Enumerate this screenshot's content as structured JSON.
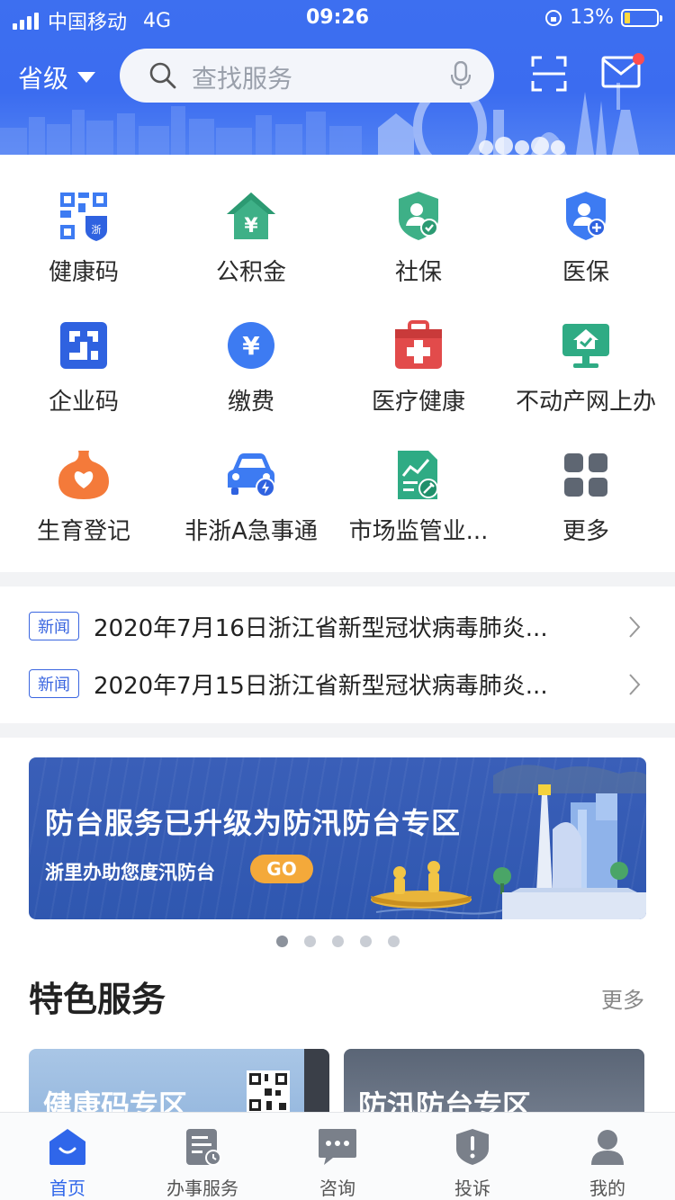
{
  "status_bar": {
    "carrier": "中国移动",
    "network": "4G",
    "time": "09:26",
    "battery": "13%"
  },
  "header": {
    "region_label": "省级",
    "search_placeholder": "查找服务"
  },
  "services": [
    {
      "label": "健康码",
      "icon": "health-code-icon"
    },
    {
      "label": "公积金",
      "icon": "housing-fund-icon"
    },
    {
      "label": "社保",
      "icon": "social-security-icon"
    },
    {
      "label": "医保",
      "icon": "medical-insurance-icon"
    },
    {
      "label": "企业码",
      "icon": "enterprise-code-icon"
    },
    {
      "label": "缴费",
      "icon": "payment-icon"
    },
    {
      "label": "医疗健康",
      "icon": "medical-kit-icon"
    },
    {
      "label": "不动产网上办",
      "icon": "real-estate-icon"
    },
    {
      "label": "生育登记",
      "icon": "birth-registration-icon"
    },
    {
      "label": "非浙A急事通",
      "icon": "car-icon"
    },
    {
      "label": "市场监管业...",
      "icon": "market-supervision-icon"
    },
    {
      "label": "更多",
      "icon": "more-grid-icon"
    }
  ],
  "news": [
    {
      "tag": "新闻",
      "text": "2020年7月16日浙江省新型冠状病毒肺炎..."
    },
    {
      "tag": "新闻",
      "text": "2020年7月15日浙江省新型冠状病毒肺炎..."
    }
  ],
  "banner": {
    "title": "防台服务已升级为防汛防台专区",
    "subtitle": "浙里办助您度汛防台",
    "go_label": "GO",
    "page_count": 5,
    "active_page": 1
  },
  "featured": {
    "title": "特色服务",
    "more_label": "更多",
    "cards": [
      {
        "title": "健康码专区"
      },
      {
        "title": "防汛防台专区"
      }
    ]
  },
  "tabbar": [
    {
      "label": "首页",
      "icon": "home-icon",
      "active": true
    },
    {
      "label": "办事服务",
      "icon": "service-doc-icon",
      "active": false
    },
    {
      "label": "咨询",
      "icon": "chat-icon",
      "active": false
    },
    {
      "label": "投诉",
      "icon": "complaint-shield-icon",
      "active": false
    },
    {
      "label": "我的",
      "icon": "profile-icon",
      "active": false
    }
  ],
  "colors": {
    "brand_blue": "#3b6cf0",
    "accent_orange": "#f4a93a",
    "badge_red": "#ff4d4f"
  }
}
